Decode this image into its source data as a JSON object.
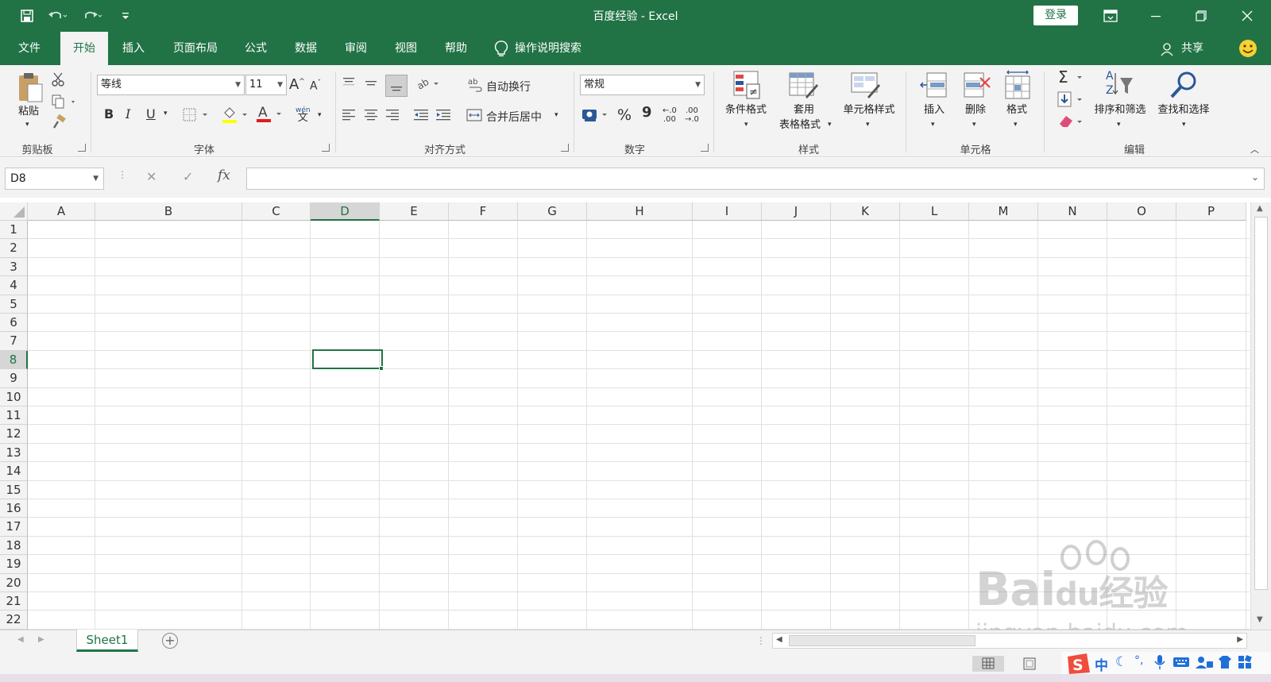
{
  "window": {
    "title": "百度经验  -  Excel",
    "login_label": "登录"
  },
  "menu": {
    "tabs": [
      "文件",
      "开始",
      "插入",
      "页面布局",
      "公式",
      "数据",
      "审阅",
      "视图",
      "帮助"
    ],
    "search_label": "操作说明搜索",
    "share_label": "共享"
  },
  "ribbon": {
    "clipboard": {
      "paste_label": "粘贴",
      "group_label": "剪贴板"
    },
    "font": {
      "font_name": "等线",
      "font_size": "11",
      "group_label": "字体",
      "bold": "B",
      "italic": "I",
      "underline": "U",
      "grow": "A",
      "shrink": "A",
      "phonetic_top": "wén",
      "phonetic_bottom": "文"
    },
    "alignment": {
      "wrap_label": "自动换行",
      "merge_label": "合并后居中",
      "group_label": "对齐方式"
    },
    "number": {
      "format": "常规",
      "group_label": "数字",
      "percent": "%",
      "comma": "9",
      "inc_decimal_top": "←.0",
      "inc_decimal_bottom": ".00",
      "dec_decimal_top": ".00",
      "dec_decimal_bottom": "→.0"
    },
    "styles": {
      "conditional_label": "条件格式",
      "table_label_1": "套用",
      "table_label_2": "表格格式",
      "cell_styles_label": "单元格样式",
      "group_label": "样式"
    },
    "cells": {
      "insert_label": "插入",
      "delete_label": "删除",
      "format_label": "格式",
      "group_label": "单元格"
    },
    "editing": {
      "sort_label": "排序和筛选",
      "find_label": "查找和选择",
      "group_label": "编辑"
    }
  },
  "formula": {
    "name_box": "D8",
    "fx_label": "fx",
    "cancel_label": "✕",
    "enter_label": "✓",
    "formula_value": ""
  },
  "grid": {
    "columns": [
      "A",
      "B",
      "C",
      "D",
      "E",
      "F",
      "G",
      "H",
      "I",
      "J",
      "K",
      "L",
      "M",
      "N",
      "O",
      "P"
    ],
    "rows": [
      "1",
      "2",
      "3",
      "4",
      "5",
      "6",
      "7",
      "8",
      "9",
      "10",
      "11",
      "12",
      "13",
      "14",
      "15",
      "16",
      "17",
      "18",
      "19",
      "20",
      "21",
      "22"
    ],
    "selected_column": "D",
    "selected_row": "8"
  },
  "sheets": {
    "tabs": [
      "Sheet1"
    ],
    "add_label": "+"
  },
  "watermark": {
    "line1_a": "Bai",
    "line1_b": "du",
    "line1_c": "经验",
    "line2": "jingyan.baidu.com"
  },
  "ime": {
    "lang_label": "中",
    "punct_label": "°,"
  },
  "colors": {
    "brand": "#217346",
    "ribbon_bg": "#f3f3f3"
  }
}
